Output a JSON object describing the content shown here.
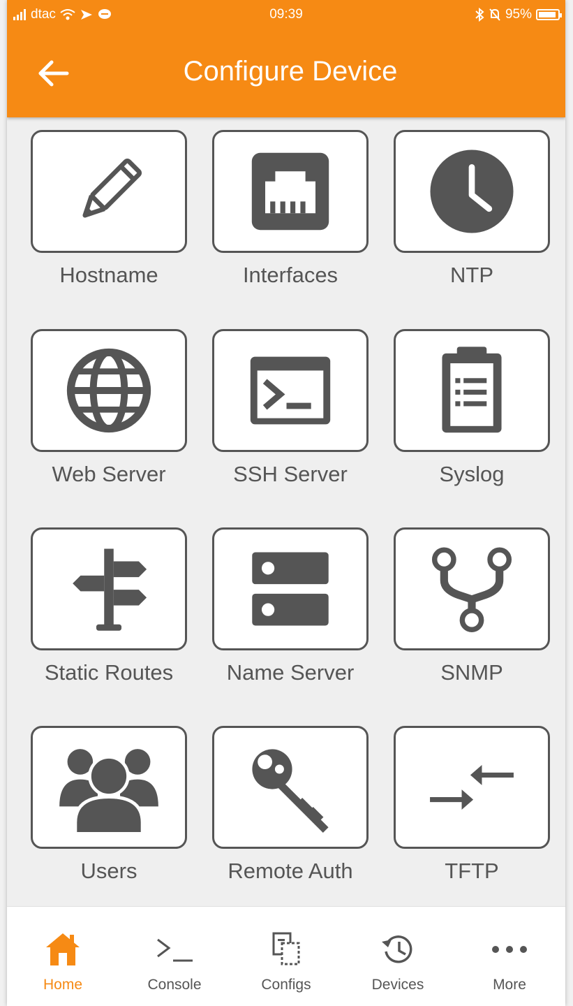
{
  "status_bar": {
    "carrier": "dtac",
    "time": "09:39",
    "battery": "95%"
  },
  "header": {
    "title": "Configure Device"
  },
  "tiles": [
    {
      "label": "Hostname",
      "icon": "pencil-icon"
    },
    {
      "label": "Interfaces",
      "icon": "ethernet-port-icon"
    },
    {
      "label": "NTP",
      "icon": "clock-icon"
    },
    {
      "label": "Web Server",
      "icon": "globe-icon"
    },
    {
      "label": "SSH Server",
      "icon": "terminal-icon"
    },
    {
      "label": "Syslog",
      "icon": "clipboard-icon"
    },
    {
      "label": "Static Routes",
      "icon": "signpost-icon"
    },
    {
      "label": "Name Server",
      "icon": "server-icon"
    },
    {
      "label": "SNMP",
      "icon": "snmp-fork-icon"
    },
    {
      "label": "Users",
      "icon": "users-icon"
    },
    {
      "label": "Remote Auth",
      "icon": "key-icon"
    },
    {
      "label": "TFTP",
      "icon": "transfer-arrows-icon"
    }
  ],
  "bottom_nav": [
    {
      "label": "Home",
      "icon": "home-icon",
      "active": true
    },
    {
      "label": "Console",
      "icon": "console-icon",
      "active": false
    },
    {
      "label": "Configs",
      "icon": "configs-icon",
      "active": false
    },
    {
      "label": "Devices",
      "icon": "history-icon",
      "active": false
    },
    {
      "label": "More",
      "icon": "more-icon",
      "active": false
    }
  ],
  "colors": {
    "accent": "#f68a14",
    "icon": "#555555"
  }
}
